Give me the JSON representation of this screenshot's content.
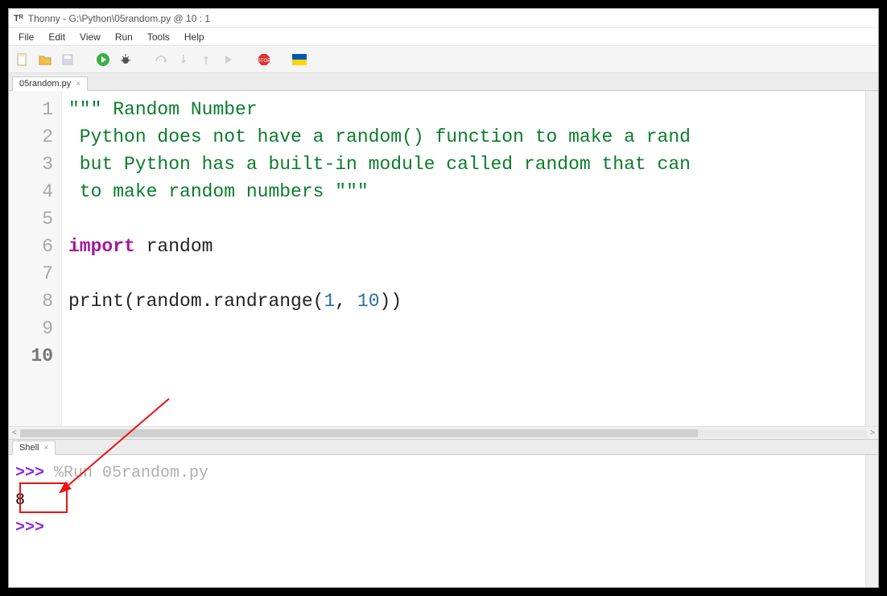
{
  "window": {
    "title": "Thonny  -  G:\\Python\\05random.py  @  10 : 1"
  },
  "menu": {
    "items": [
      "File",
      "Edit",
      "View",
      "Run",
      "Tools",
      "Help"
    ]
  },
  "toolbar_icons": {
    "new": "new-file-icon",
    "open": "open-file-icon",
    "save": "save-file-icon",
    "run": "run-icon",
    "debug": "debug-icon",
    "step_over": "step-over-icon",
    "step_into": "step-into-icon",
    "step_out": "step-out-icon",
    "resume": "resume-icon",
    "stop": "stop-icon",
    "flag": "flag-icon"
  },
  "editor_tab": {
    "label": "05random.py"
  },
  "code": {
    "line_count": 10,
    "current_line": 10,
    "l1_a": "\"\"\"",
    "l1_b": " Random Number",
    "l2": " Python does not have a random() function to make a rand",
    "l3": " but Python has a built-in module called random that can",
    "l4_a": " to make random numbers ",
    "l4_b": "\"\"\"",
    "l5": "",
    "l6_kw": "import",
    "l6_mod": " random",
    "l7": "",
    "l8_fn": "print",
    "l8_p1": "(",
    "l8_call": "random.randrange",
    "l8_p2": "(",
    "l8_n1": "1",
    "l8_comma": ", ",
    "l8_n2": "10",
    "l8_p3": ")",
    "l8_p4": ")",
    "l9": "",
    "l10": ""
  },
  "shell_tab": {
    "label": "Shell"
  },
  "shell": {
    "prompt": ">>>",
    "run_cmd": "%Run 05random.py",
    "output": "8"
  }
}
